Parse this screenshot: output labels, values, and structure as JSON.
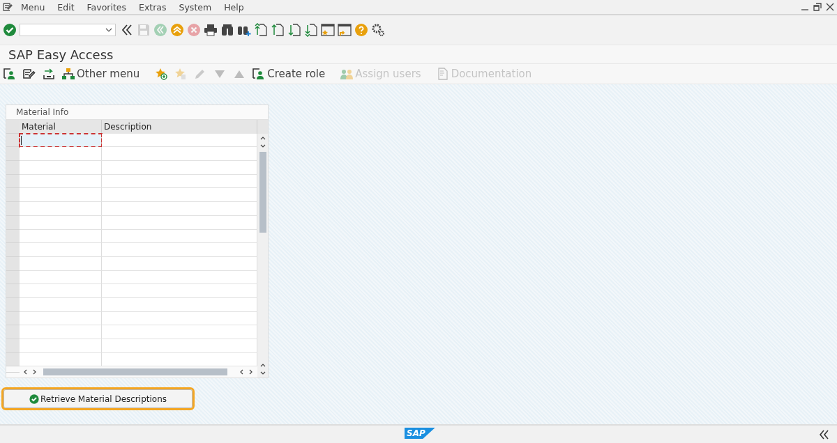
{
  "menu_bar": {
    "items": [
      {
        "label": "Menu"
      },
      {
        "label": "Edit"
      },
      {
        "label": "Favorites"
      },
      {
        "label": "Extras"
      },
      {
        "label": "System"
      },
      {
        "label": "Help"
      }
    ]
  },
  "toolbar": {
    "items": [
      {
        "kind": "enter",
        "disabled": false
      },
      {
        "kind": "command"
      },
      {
        "kind": "collapse",
        "disabled": false
      },
      {
        "kind": "save",
        "disabled": true
      },
      {
        "kind": "back",
        "disabled": true
      },
      {
        "kind": "exit",
        "disabled": false
      },
      {
        "kind": "cancel",
        "disabled": true
      },
      {
        "kind": "print",
        "disabled": false
      },
      {
        "kind": "find",
        "disabled": false
      },
      {
        "kind": "find-next",
        "disabled": false
      },
      {
        "kind": "first-page",
        "disabled": false
      },
      {
        "kind": "prev-page",
        "disabled": false
      },
      {
        "kind": "next-page",
        "disabled": false
      },
      {
        "kind": "last-page",
        "disabled": false
      },
      {
        "kind": "new-session",
        "disabled": false
      },
      {
        "kind": "shortcut",
        "disabled": false
      },
      {
        "kind": "help",
        "disabled": false
      },
      {
        "kind": "settings",
        "disabled": false
      }
    ]
  },
  "title": "SAP Easy Access",
  "app_toolbar": {
    "items": [
      {
        "kind": "user-menu",
        "disabled": false
      },
      {
        "kind": "sap-menu",
        "disabled": false
      },
      {
        "kind": "download",
        "disabled": false
      },
      {
        "kind": "tree",
        "label": "Other menu",
        "disabled": false
      },
      {
        "kind": "add-favorite",
        "disabled": false
      },
      {
        "kind": "delete-favorite",
        "disabled": true
      },
      {
        "kind": "edit",
        "disabled": true
      },
      {
        "kind": "move-down",
        "disabled": true
      },
      {
        "kind": "move-up",
        "disabled": true
      },
      {
        "kind": "user-menu",
        "label": "Create role",
        "disabled": false
      },
      {
        "kind": "users",
        "label": "Assign users",
        "disabled": true
      },
      {
        "kind": "document",
        "label": "Documentation",
        "disabled": true
      }
    ]
  },
  "table": {
    "title": "Material Info",
    "columns": [
      "Material",
      "Description"
    ],
    "rows": [
      {
        "focused": true
      },
      {
        "focused": false
      },
      {
        "focused": false
      },
      {
        "focused": false
      },
      {
        "focused": false
      },
      {
        "focused": false
      },
      {
        "focused": false
      },
      {
        "focused": false
      },
      {
        "focused": false
      },
      {
        "focused": false
      },
      {
        "focused": false
      },
      {
        "focused": false
      },
      {
        "focused": false
      },
      {
        "focused": false
      },
      {
        "focused": false
      },
      {
        "focused": false
      },
      {
        "focused": false
      }
    ]
  },
  "button": {
    "label": "Retrieve Material Descriptions",
    "focused": true
  },
  "status_bar": {
    "logo": "SAP"
  }
}
